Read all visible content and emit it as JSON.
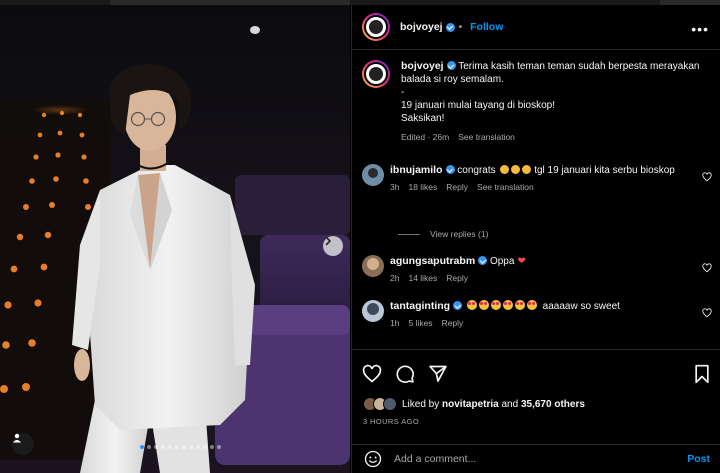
{
  "post": {
    "author": "bojvoyej",
    "follow_label": "Follow",
    "separator": "•",
    "more_label": "•••",
    "carousel_total": 12,
    "carousel_active": 1
  },
  "caption": {
    "username": "bojvoyej",
    "line1": "Terima kasih teman teman sudah berpesta merayakan balada si roy semalam.",
    "line2": "-",
    "line3": "19 januari mulai tayang di bioskop!",
    "line4": "Saksikan!",
    "edited": "Edited · 26m",
    "see_translation": "See translation"
  },
  "comments": [
    {
      "username": "ibnujamilo",
      "text_before": "congrats",
      "text_after": "tgl 19 januari kita serbu bioskop",
      "time": "3h",
      "likes": "18 likes",
      "reply": "Reply",
      "see_translation": "See translation",
      "view_replies": "View replies (1)"
    },
    {
      "username": "agungsaputrabm",
      "text": "Oppa",
      "time": "2h",
      "likes": "14 likes",
      "reply": "Reply"
    },
    {
      "username": "tantaginting",
      "text": "aaaaaw so sweet",
      "time": "1h",
      "likes": "5 likes",
      "reply": "Reply"
    }
  ],
  "likes": {
    "prefix": "Liked by",
    "user": "novitapetria",
    "middle": "and",
    "count": "35,670 others"
  },
  "time_ago": "3 HOURS AGO",
  "comment_box": {
    "placeholder": "Add a comment...",
    "post_label": "Post"
  },
  "colors": {
    "accent": "#0095f6",
    "verified": "#3797f0",
    "heart": "#ed4956",
    "seat_purple": "#5a3f80",
    "suit": "#eeeeee"
  },
  "icons": [
    "more-icon",
    "verified-icon",
    "heart-icon",
    "comment-icon",
    "share-icon",
    "bookmark-icon",
    "emoji-icon",
    "chevron-right-icon",
    "user-tag-icon"
  ]
}
